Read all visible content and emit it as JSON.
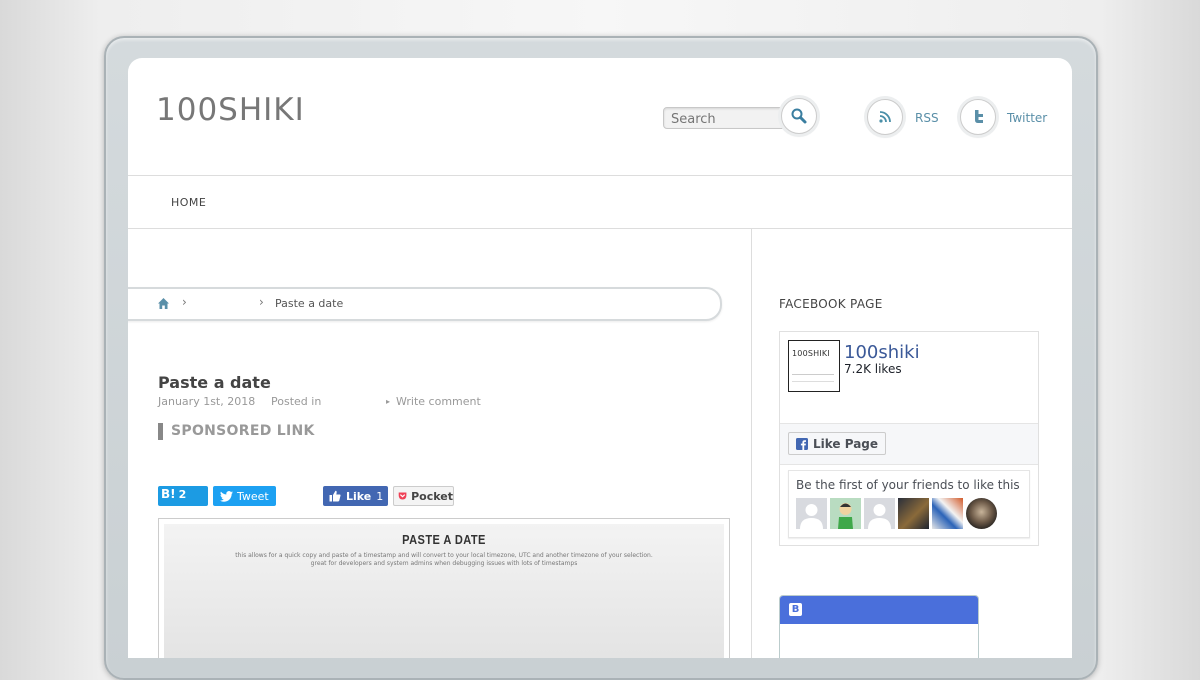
{
  "site": {
    "title": "100SHIKI"
  },
  "search": {
    "placeholder": "Search"
  },
  "social": {
    "rss_label": "RSS",
    "twitter_label": "Twitter"
  },
  "nav": {
    "items": [
      {
        "label": "HOME"
      }
    ]
  },
  "breadcrumb": {
    "current": "Paste a date"
  },
  "post": {
    "title": "Paste a date",
    "date": "January 1st, 2018",
    "posted_in": "Posted in",
    "write_comment": "Write comment",
    "sponsored": "SPONSORED LINK"
  },
  "share": {
    "hatena_count": "2",
    "tweet_label": "Tweet",
    "like_label": "Like",
    "like_count": "1",
    "pocket_label": "Pocket"
  },
  "screenshot": {
    "title": "PASTE A DATE",
    "desc_line1": "this allows for a quick copy and paste of a timestamp and will convert to your local timezone, UTC and another timezone of your selection.",
    "desc_line2": "great for developers and system admins when debugging issues with lots of timestamps"
  },
  "sidebar": {
    "fb_heading": "FACEBOOK PAGE",
    "fb_page_name": "100shiki",
    "fb_likes": "7.2K likes",
    "fb_like_button": "Like Page",
    "fb_friends_text": "Be the first of your friends to like this",
    "fb_thumb_text": "100SHIKI"
  },
  "colors": {
    "accent": "#5a8fa8",
    "facebook": "#3b5998",
    "hatena": "#4a6fdb"
  }
}
